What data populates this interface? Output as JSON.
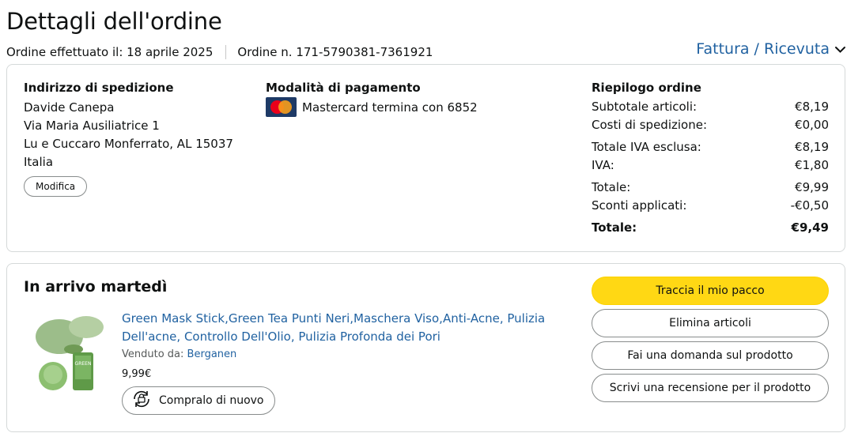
{
  "header": {
    "title": "Dettagli dell'ordine",
    "order_date": "Ordine effettuato il: 18 aprile 2025",
    "order_number": "Ordine n. 171-5790381-7361921",
    "invoice_link": "Fattura / Ricevuta",
    "invoice_icon": "chevron-down-icon"
  },
  "shipping": {
    "title": "Indirizzo di spedizione",
    "lines": [
      "Davide Canepa",
      "Via Maria Ausiliatrice 1",
      "Lu e Cuccaro Monferrato, AL 15037",
      "Italia"
    ],
    "modify_label": "Modifica"
  },
  "payment": {
    "title": "Modalità di pagamento",
    "card_icon": "mastercard-icon",
    "card_text": "Mastercard termina con 6852"
  },
  "summary": {
    "title": "Riepilogo ordine",
    "rows": [
      {
        "label": "Subtotale articoli:",
        "value": "€8,19"
      },
      {
        "label": "Costi di spedizione:",
        "value": "€0,00"
      },
      {
        "label": "Totale IVA esclusa:",
        "value": "€8,19"
      },
      {
        "label": "IVA:",
        "value": "€1,80"
      },
      {
        "label": "Totale:",
        "value": "€9,99"
      },
      {
        "label": "Sconti applicati:",
        "value": "-€0,50"
      }
    ],
    "grand_total_label": "Totale:",
    "grand_total_value": "€9,49"
  },
  "shipment": {
    "title": "In arrivo martedì",
    "product_title": "Green Mask Stick,Green Tea Punti Neri,Maschera Viso,Anti-Acne, Pulizia Dell'acne, Controllo Dell'Olio, Pulizia Profonda dei Pori",
    "sold_by_label": "Venduto da:",
    "seller": "Berganen",
    "price": "9,99€",
    "buy_again_label": "Compralo di nuovo",
    "buy_again_icon": "buy-again-icon",
    "product_image_text": "GREEN",
    "actions": {
      "track": "Traccia il mio pacco",
      "delete": "Elimina articoli",
      "question": "Fai una domanda sul prodotto",
      "review": "Scrivi una recensione per il prodotto"
    }
  },
  "colors": {
    "link": "#2162a1",
    "primary_button": "#ffd814",
    "border": "#d5d9d9",
    "text": "#0f1111"
  }
}
